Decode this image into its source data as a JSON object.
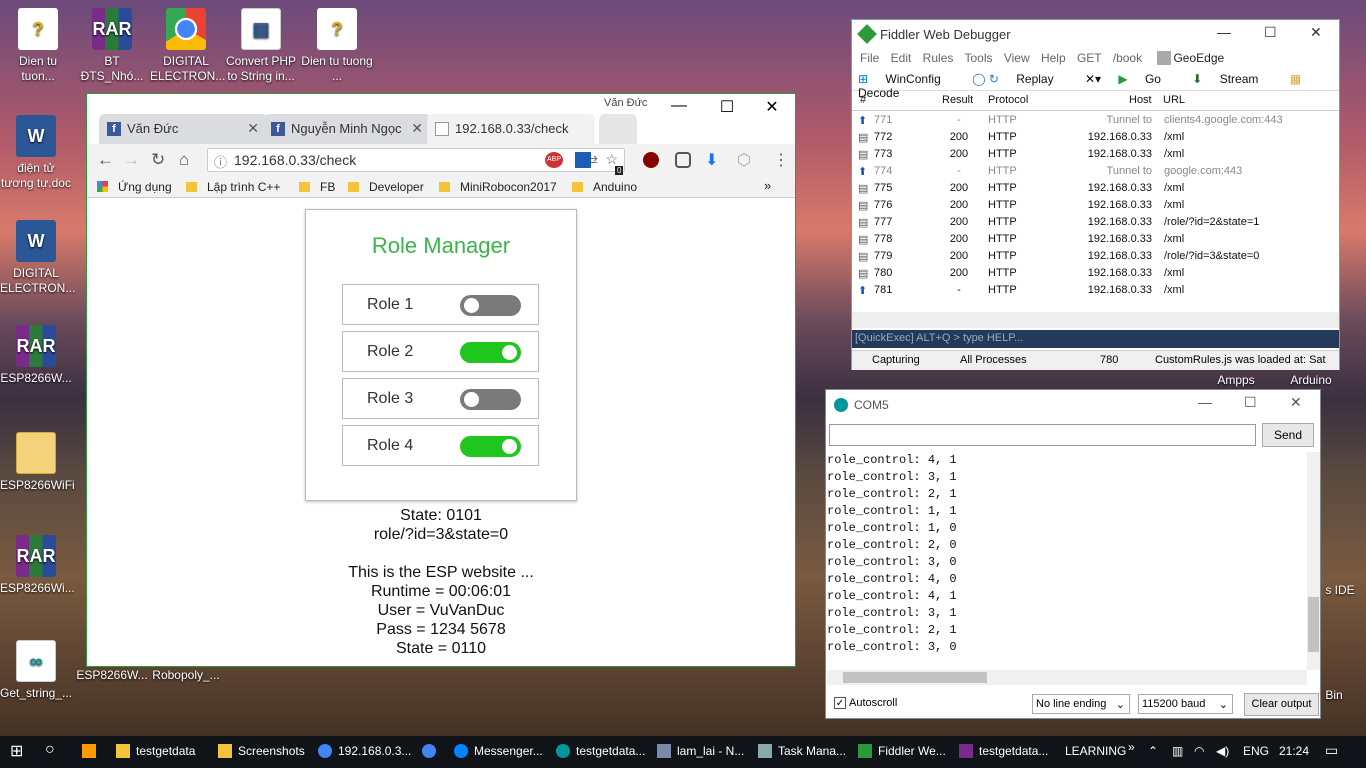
{
  "desktop": {
    "icons": [
      {
        "label": "Dien tu tuon...",
        "icon": "question-doc-icon"
      },
      {
        "label": "BT ĐTS_Nhó...",
        "icon": "winrar-icon"
      },
      {
        "label": "DIGITAL ELECTRON...",
        "icon": "chrome-icon"
      },
      {
        "label": "Convert PHP to String in...",
        "icon": "app-icon"
      },
      {
        "label": "Dien tu tuong ...",
        "icon": "question-doc-icon"
      },
      {
        "label": "điện tử tương tự.doc",
        "icon": "word-icon"
      },
      {
        "label": "DIGITAL ELECTRON...",
        "icon": "word-icon"
      },
      {
        "label": "ESP8266W...",
        "icon": "winrar-icon"
      },
      {
        "label": "ESP8266WiFi",
        "icon": "folder-icon"
      },
      {
        "label": "ESP8266Wi...",
        "icon": "winrar-icon"
      },
      {
        "label": "Get_string_...",
        "icon": "arduino-icon"
      },
      {
        "label": "ESP8266W...",
        "icon": "folder-icon"
      },
      {
        "label": "Robopoly_...",
        "icon": "folder-icon"
      },
      {
        "label": "Ampps",
        "icon": "app-icon"
      },
      {
        "label": "Arduino",
        "icon": "app-icon"
      },
      {
        "label": "s IDE",
        "icon": "app-icon"
      },
      {
        "label": "Bin",
        "icon": "recycle-bin-icon"
      }
    ]
  },
  "chrome": {
    "tabs": [
      {
        "label": "Văn Đức"
      },
      {
        "label": "Nguyễn Minh Ngọc"
      },
      {
        "label": "192.168.0.33/check"
      }
    ],
    "profile": "Văn Đức",
    "url": "192.168.0.33/check",
    "bookmarks": [
      "Ứng dụng",
      "Lập trình C++",
      "FB",
      "Developer",
      "MiniRobocon2017",
      "Anduino"
    ],
    "bookmarks_more": "»",
    "ext_badge": "0",
    "page": {
      "title": "Role Manager",
      "roles": [
        {
          "label": "Role 1",
          "state": "off"
        },
        {
          "label": "Role 2",
          "state": "on"
        },
        {
          "label": "Role 3",
          "state": "off"
        },
        {
          "label": "Role 4",
          "state": "on"
        }
      ],
      "lines": [
        "State: 0101",
        "role/?id=3&state=0",
        "",
        "This is the ESP website ...",
        "Runtime = 00:06:01",
        "User = VuVanDuc",
        "Pass = 1234 5678",
        "State = 0110"
      ]
    }
  },
  "fiddler": {
    "title": "Fiddler Web Debugger",
    "menu": "File Edit Rules Tools View Help GET /book",
    "menu_geoedge": "GeoEdge",
    "toolbar": [
      "WinConfig",
      "Replay",
      "Go",
      "Stream",
      "Decode"
    ],
    "columns": [
      "#",
      "Result",
      "Protocol",
      "Host",
      "URL"
    ],
    "rows": [
      {
        "id": "771",
        "result": "-",
        "protocol": "HTTP",
        "host": "Tunnel to",
        "url": "clients4.google.com:443",
        "dim": true
      },
      {
        "id": "772",
        "result": "200",
        "protocol": "HTTP",
        "host": "192.168.0.33",
        "url": "/xml"
      },
      {
        "id": "773",
        "result": "200",
        "protocol": "HTTP",
        "host": "192.168.0.33",
        "url": "/xml"
      },
      {
        "id": "774",
        "result": "-",
        "protocol": "HTTP",
        "host": "Tunnel to",
        "url": "google.com:443",
        "dim": true
      },
      {
        "id": "775",
        "result": "200",
        "protocol": "HTTP",
        "host": "192.168.0.33",
        "url": "/xml"
      },
      {
        "id": "776",
        "result": "200",
        "protocol": "HTTP",
        "host": "192.168.0.33",
        "url": "/xml"
      },
      {
        "id": "777",
        "result": "200",
        "protocol": "HTTP",
        "host": "192.168.0.33",
        "url": "/role/?id=2&state=1"
      },
      {
        "id": "778",
        "result": "200",
        "protocol": "HTTP",
        "host": "192.168.0.33",
        "url": "/xml"
      },
      {
        "id": "779",
        "result": "200",
        "protocol": "HTTP",
        "host": "192.168.0.33",
        "url": "/role/?id=3&state=0"
      },
      {
        "id": "780",
        "result": "200",
        "protocol": "HTTP",
        "host": "192.168.0.33",
        "url": "/xml"
      },
      {
        "id": "781",
        "result": "-",
        "protocol": "HTTP",
        "host": "192.168.0.33",
        "url": "/xml"
      }
    ],
    "quickexec": "[QuickExec] ALT+Q > type HELP...",
    "status": {
      "capturing": "Capturing",
      "processes": "All Processes",
      "count": "780",
      "message": "CustomRules.js was loaded at: Sat"
    }
  },
  "com": {
    "title": "COM5",
    "send": "Send",
    "log": [
      "role_control: 4, 1",
      "role_control: 3, 1",
      "role_control: 2, 1",
      "role_control: 1, 1",
      "role_control: 1, 0",
      "role_control: 2, 0",
      "role_control: 3, 0",
      "role_control: 4, 0",
      "role_control: 4, 1",
      "role_control: 3, 1",
      "role_control: 2, 1",
      "role_control: 3, 0"
    ],
    "autoscroll": "Autoscroll",
    "line_ending": "No line ending",
    "baud": "115200 baud",
    "clear": "Clear output"
  },
  "taskbar": {
    "items": [
      "testgetdata",
      "Screenshots",
      "192.168.0.3...",
      "",
      "Messenger...",
      "testgetdata...",
      "lam_lai - N...",
      "Task Mana...",
      "Fiddler We...",
      "testgetdata..."
    ],
    "learning": "LEARNING",
    "lang": "ENG",
    "time": "21:24"
  }
}
